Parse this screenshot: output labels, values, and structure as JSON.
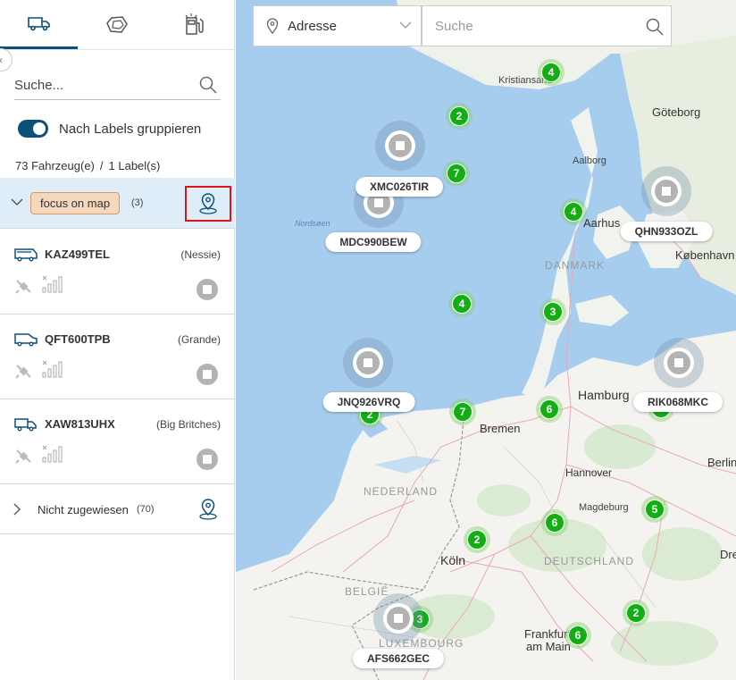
{
  "sidebar": {
    "tabs": [
      {
        "name": "vehicles",
        "icon": "truck-icon"
      },
      {
        "name": "geofences",
        "icon": "polygon-icon"
      },
      {
        "name": "pois",
        "icon": "fuel-station-icon"
      }
    ],
    "search_placeholder": "Suche...",
    "group_toggle_label": "Nach Labels gruppieren",
    "group_toggle_on": true,
    "vehicle_count_text": "73 Fahrzeug(e)",
    "label_count_text": "1 Label(s)",
    "label_group": {
      "name": "focus on map",
      "count": "(3)"
    },
    "vehicles": [
      {
        "plate": "KAZ499TEL",
        "group": "(Nessie)",
        "icon": "bus-icon"
      },
      {
        "plate": "QFT600TPB",
        "group": "(Grande)",
        "icon": "van-icon"
      },
      {
        "plate": "XAW813UHX",
        "group": "(Big Britches)",
        "icon": "truck-icon"
      }
    ],
    "unassigned": {
      "label": "Nicht zugewiesen",
      "count": "(70)"
    }
  },
  "map": {
    "address_select": "Adresse",
    "search_placeholder": "Suche",
    "place_labels": [
      {
        "text": "Kristiansand",
        "kind": "city"
      },
      {
        "text": "Göteborg",
        "kind": "city"
      },
      {
        "text": "Aalborg",
        "kind": "small"
      },
      {
        "text": "Nordsøen",
        "kind": "sea"
      },
      {
        "text": "Aarhus",
        "kind": "city"
      },
      {
        "text": "DANMARK",
        "kind": "country"
      },
      {
        "text": "København",
        "kind": "city"
      },
      {
        "text": "Hamburg",
        "kind": "city"
      },
      {
        "text": "Bremen",
        "kind": "city"
      },
      {
        "text": "Berlin",
        "kind": "city"
      },
      {
        "text": "Hannover",
        "kind": "city"
      },
      {
        "text": "NEDERLAND",
        "kind": "country"
      },
      {
        "text": "Magdeburg",
        "kind": "small"
      },
      {
        "text": "DEUTSCHLAND",
        "kind": "country"
      },
      {
        "text": "Köln",
        "kind": "city"
      },
      {
        "text": "BELGIË",
        "kind": "country"
      },
      {
        "text": "Dres",
        "kind": "city"
      },
      {
        "text": "Frankfurt",
        "kind": "city"
      },
      {
        "text": "am Main",
        "kind": "city"
      },
      {
        "text": "LUXEMBOURG",
        "kind": "country"
      }
    ],
    "clusters": [
      {
        "count": "4"
      },
      {
        "count": "2"
      },
      {
        "count": "7"
      },
      {
        "count": "4"
      },
      {
        "count": "4"
      },
      {
        "count": "3"
      },
      {
        "count": "2"
      },
      {
        "count": "7"
      },
      {
        "count": "6"
      },
      {
        "count": "6"
      },
      {
        "count": "5"
      },
      {
        "count": "2"
      },
      {
        "count": "3"
      },
      {
        "count": "6"
      },
      {
        "count": "2"
      }
    ],
    "vehicle_labels": [
      {
        "plate": "XMC026TIR"
      },
      {
        "plate": "MDC990BEW"
      },
      {
        "plate": "QHN933OZL"
      },
      {
        "plate": "JNQ926VRQ"
      },
      {
        "plate": "RIK068MKC"
      },
      {
        "plate": "AFS662GEC"
      }
    ]
  },
  "colors": {
    "accent": "#0c4f7a",
    "cluster_green": "#13ae13",
    "highlight_red": "#e0141c",
    "label_chip": "#f4d7bd",
    "selected_row": "#deedf8"
  }
}
